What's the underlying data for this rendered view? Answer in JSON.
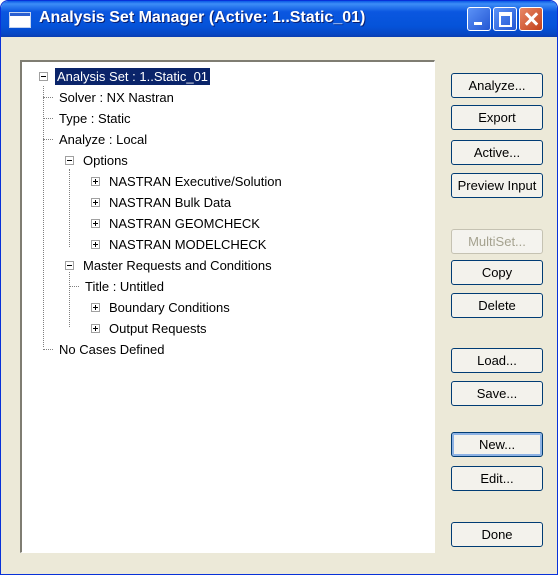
{
  "window": {
    "title": "Analysis Set Manager (Active: 1..Static_01)"
  },
  "tree": {
    "root": "Analysis Set : 1..Static_01",
    "solver": "Solver : NX Nastran",
    "type": "Type : Static",
    "analyze": "Analyze : Local",
    "options": "Options",
    "nastran_exec": "NASTRAN Executive/Solution",
    "nastran_bulk": "NASTRAN Bulk Data",
    "nastran_geomcheck": "NASTRAN GEOMCHECK",
    "nastran_modelcheck": "NASTRAN MODELCHECK",
    "master_requests": "Master Requests and Conditions",
    "title": "Title : Untitled",
    "boundary": "Boundary Conditions",
    "output": "Output Requests",
    "no_cases": "No Cases Defined"
  },
  "buttons": {
    "analyze": "Analyze...",
    "export": "Export",
    "active": "Active...",
    "preview": "Preview Input",
    "multiset": "MultiSet...",
    "copy": "Copy",
    "delete": "Delete",
    "load": "Load...",
    "save": "Save...",
    "new": "New...",
    "edit": "Edit...",
    "done": "Done"
  }
}
